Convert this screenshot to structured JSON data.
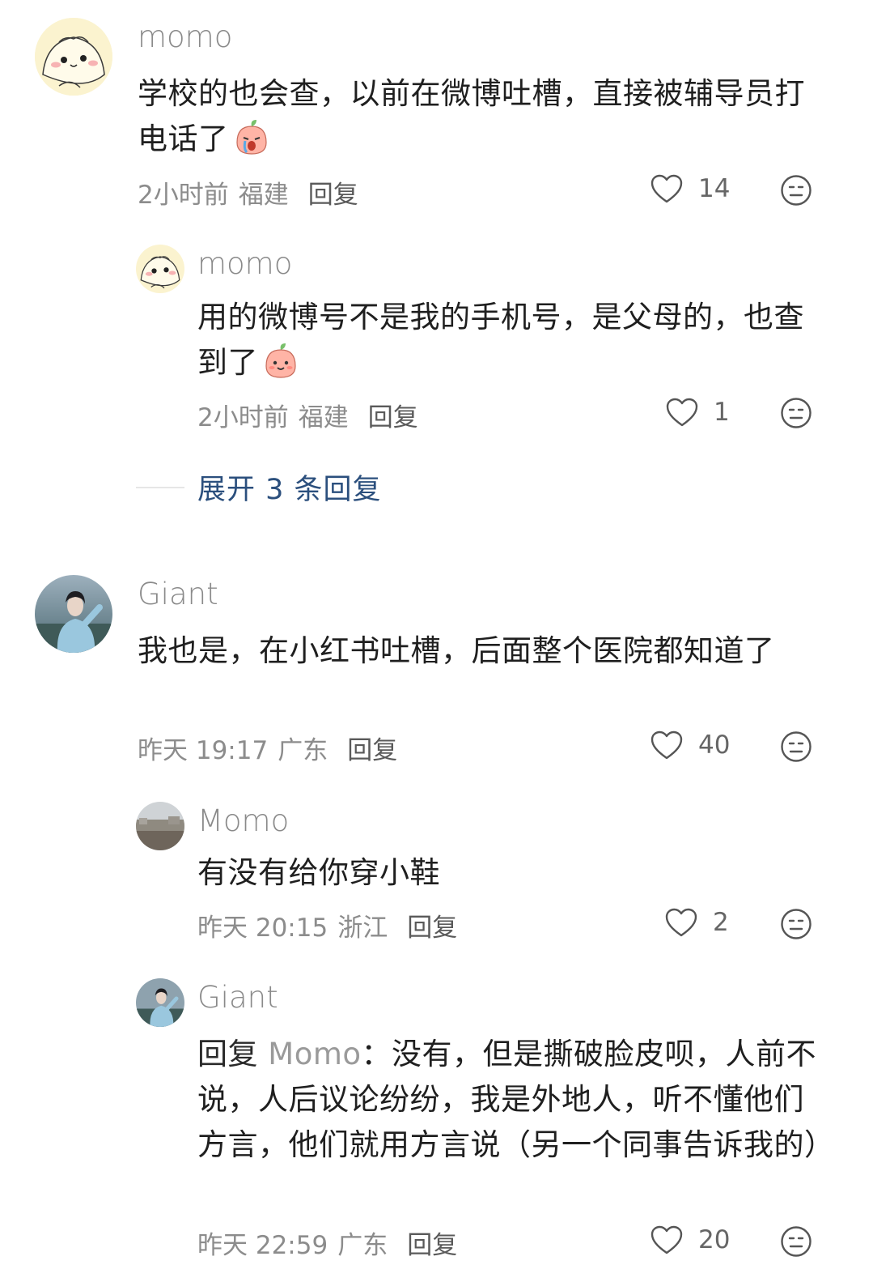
{
  "comments": [
    {
      "name": "momo",
      "text": "学校的也会查，以前在微博吐槽，直接被辅导员打电话了",
      "time": "2小时前",
      "location": "福建",
      "reply": "回复",
      "likes": "14",
      "avatar": "cartoon-dumpling-avatar",
      "emoji": "crying-peach-emoji",
      "replies": [
        {
          "name": "momo",
          "text": "用的微博号不是我的手机号，是父母的，也查到了",
          "time": "2小时前",
          "location": "福建",
          "reply": "回复",
          "likes": "1",
          "avatar": "cartoon-dumpling-avatar",
          "emoji": "smiling-peach-emoji"
        }
      ],
      "expand_label": "展开 3 条回复"
    },
    {
      "name": "Giant",
      "text": "我也是，在小红书吐槽，后面整个医院都知道了",
      "time": "昨天 19:17",
      "location": "广东",
      "reply": "回复",
      "likes": "40",
      "avatar": "woman-photo-avatar",
      "replies": [
        {
          "name": "Momo",
          "text": "有没有给你穿小鞋",
          "time": "昨天 20:15",
          "location": "浙江",
          "reply": "回复",
          "likes": "2",
          "avatar": "landscape-photo-avatar"
        },
        {
          "name": "Giant",
          "reply_prefix": "回复",
          "mention": "Momo",
          "colon": "：",
          "text": "没有，但是撕破脸皮呗，人前不说，人后议论纷纷，我是外地人，听不懂他们方言，他们就用方言说（另一个同事告诉我的）",
          "time": "昨天 22:59",
          "location": "广东",
          "reply": "回复",
          "likes": "20",
          "avatar": "woman-photo-avatar"
        }
      ]
    }
  ],
  "colors": {
    "expand_link": "#2b4f7d",
    "meta": "#8c8c8c",
    "name": "#8a8a8a"
  }
}
